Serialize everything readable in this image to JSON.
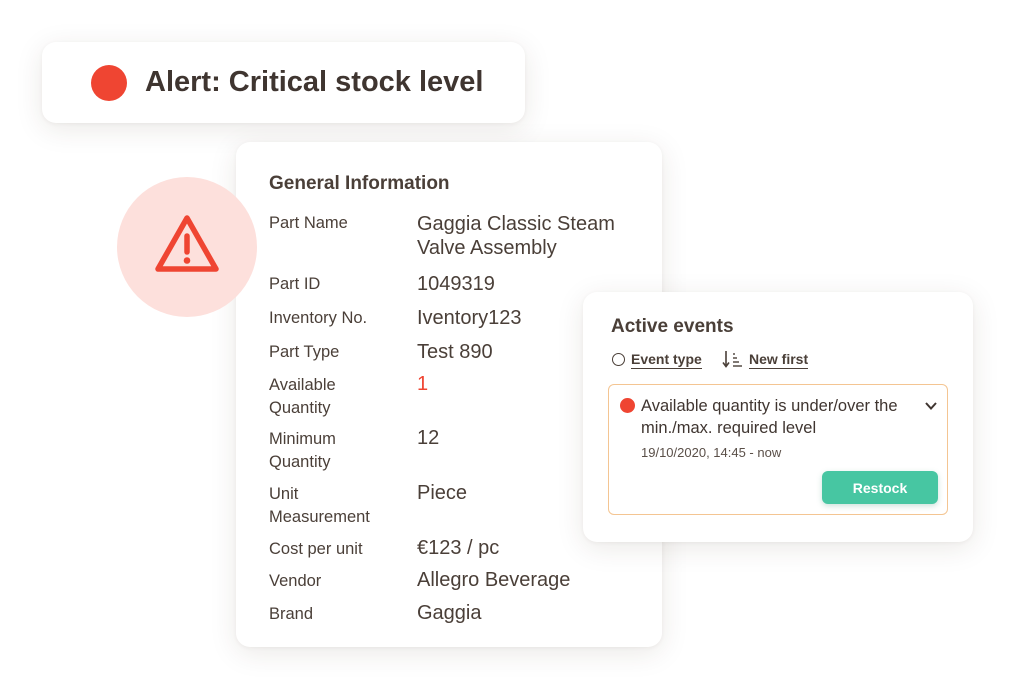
{
  "alert": {
    "title": "Alert: Critical stock level",
    "color": "#ef4532",
    "icon": "warning-triangle-icon"
  },
  "general": {
    "title": "General Information",
    "fields": [
      {
        "label": "Part Name",
        "value": "Gaggia Classic Steam Valve Assembly"
      },
      {
        "label": "Part ID",
        "value": "1049319"
      },
      {
        "label": "Inventory No.",
        "value": "Iventory123"
      },
      {
        "label": "Part Type",
        "value": "Test 890"
      },
      {
        "label": "Available Quantity",
        "value": "1"
      },
      {
        "label": "Minimum Quantity",
        "value": "12"
      },
      {
        "label": "Unit Measurement",
        "value": "Piece"
      },
      {
        "label": "Cost per unit",
        "value": "€123 / pc"
      },
      {
        "label": "Vendor",
        "value": "Allegro Beverage"
      },
      {
        "label": "Brand",
        "value": "Gaggia"
      }
    ]
  },
  "events": {
    "title": "Active events",
    "filter_type": "Event type",
    "filter_sort": "New first",
    "item": {
      "text": "Available quantity is under/over the min./max. required level",
      "time": "19/10/2020, 14:45 - now",
      "action": "Restock"
    }
  },
  "colors": {
    "accent_red": "#ef4532",
    "restock_green": "#47c6a2",
    "event_border": "#f4c592"
  }
}
